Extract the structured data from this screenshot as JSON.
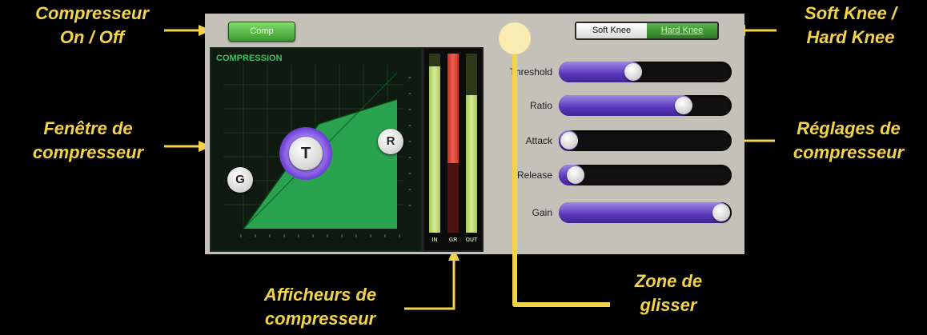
{
  "callouts": {
    "compressor_onoff": [
      "Compresseur",
      "On / Off"
    ],
    "knee": [
      "Soft Knee /",
      "Hard Knee"
    ],
    "window": [
      "Fenêtre de",
      "compresseur"
    ],
    "settings": [
      "Réglages de",
      "compresseur"
    ],
    "meters": [
      "Afficheurs de",
      "compresseur"
    ],
    "drag_zone": [
      "Zone de",
      "glisser"
    ]
  },
  "colors": {
    "callout": "#f3d34a",
    "accent_green": "#3c9a31",
    "slider_purple": "#5936b8",
    "background": "#000000"
  },
  "comp_button": {
    "label": "Comp",
    "state": "on"
  },
  "knee_toggle": {
    "soft_label": "Soft Knee",
    "hard_label": "Hard Knee",
    "selected": "hard"
  },
  "graph": {
    "title": "COMPRESSION",
    "nodes": {
      "gain": "G",
      "threshold": "T",
      "ratio": "R"
    }
  },
  "meters": {
    "in_label": "IN",
    "gr_label": "GR",
    "out_label": "OUT",
    "in_level": 0.93,
    "gr_level": 0.61,
    "out_level": 0.77
  },
  "sliders": [
    {
      "label": "Threshold",
      "value": 0.42
    },
    {
      "label": "Ratio",
      "value": 0.75
    },
    {
      "label": "Attack",
      "value": 0.0
    },
    {
      "label": "Release",
      "value": 0.04
    },
    {
      "label": "Gain",
      "value": 1.0
    }
  ]
}
